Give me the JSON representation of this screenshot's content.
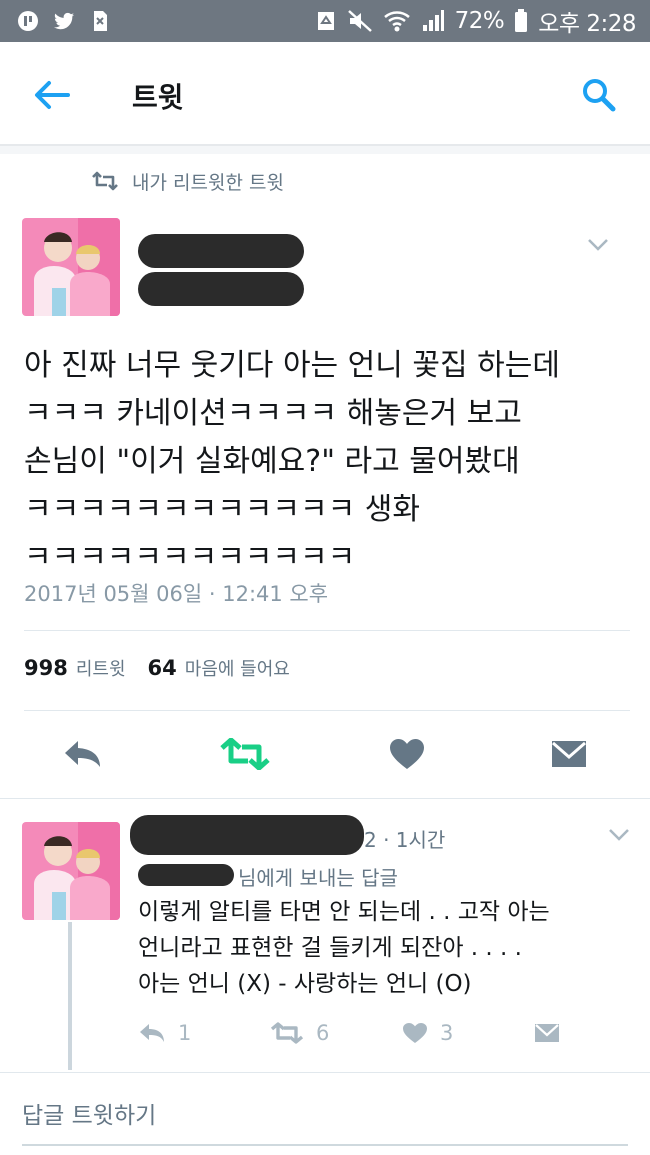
{
  "status_bar": {
    "battery": "72%",
    "time": "오후 2:28",
    "icons": [
      "app-icon",
      "twitter-bird-icon",
      "sim-card-icon",
      "recycle-icon",
      "mute-icon",
      "wifi-icon",
      "signal-icon",
      "battery-icon"
    ]
  },
  "header": {
    "title": "트윗",
    "back_icon": "back-arrow-icon",
    "search_icon": "search-icon"
  },
  "retweet_context": {
    "label": "내가 리트윗한 트윗",
    "icon": "retweet-icon"
  },
  "tweet": {
    "text": "아 진짜 너무 웃기다 아는 언니 꽃집 하는데\nㅋㅋㅋ 카네이션ㅋㅋㅋㅋ 해놓은거 보고\n손님이 \"이거 실화예요?\" 라고 물어봤대\nㅋㅋㅋㅋㅋㅋㅋㅋㅋㅋㅋㅋ 생화\nㅋㅋㅋㅋㅋㅋㅋㅋㅋㅋㅋㅋ",
    "timestamp": "2017년 05월 06일 · 12:41 오후",
    "retweet_count": "998",
    "retweet_label": "리트윗",
    "like_count": "64",
    "like_label": "마음에 들어요",
    "colors": {
      "retweet_active": "#19cf86",
      "action_gray": "#657786"
    }
  },
  "reply": {
    "time": "2 · 1시간",
    "reply_to": "님에게 보내는 답글",
    "text": "이렇게 알티를 타면 안 되는데 . . 고작 아는\n언니라고 표현한 걸 들키게 되잔아 . . . .\n아는 언니 (X) - 사랑하는 언니 (O)",
    "reply_count": "1",
    "retweet_count": "6",
    "like_count": "3"
  },
  "compose": {
    "placeholder": "답글 트윗하기"
  }
}
